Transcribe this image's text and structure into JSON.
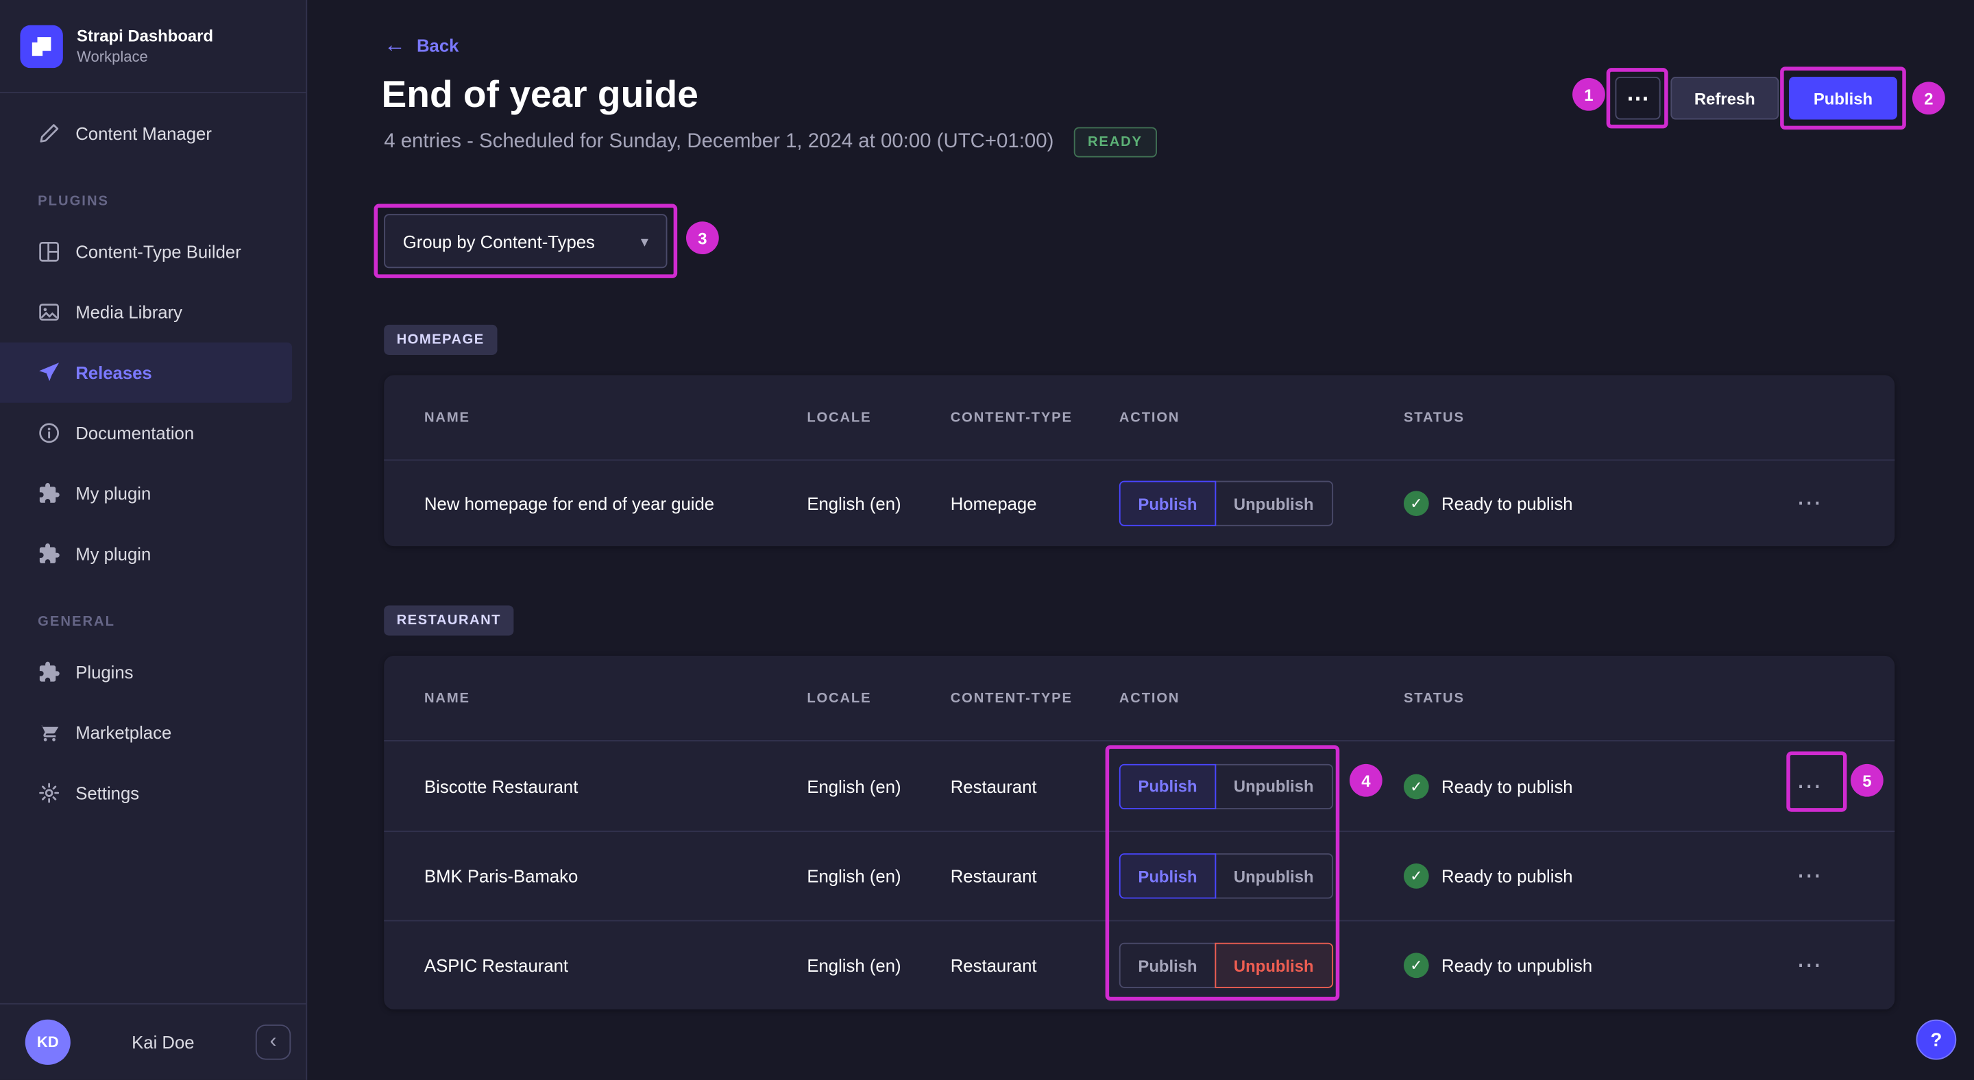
{
  "icons": {
    "back_arrow": "←",
    "more": "⋯",
    "caret": "▾",
    "collapse": "‹",
    "check": "✓",
    "help": "?"
  },
  "sidebar": {
    "brand": {
      "title": "Strapi Dashboard",
      "subtitle": "Workplace"
    },
    "content_manager": "Content Manager",
    "sections": [
      {
        "heading": "PLUGINS",
        "items": [
          {
            "label": "Content-Type Builder"
          },
          {
            "label": "Media Library"
          },
          {
            "label": "Releases"
          },
          {
            "label": "Documentation"
          },
          {
            "label": "My plugin"
          },
          {
            "label": "My plugin"
          }
        ]
      },
      {
        "heading": "GENERAL",
        "items": [
          {
            "label": "Plugins"
          },
          {
            "label": "Marketplace"
          },
          {
            "label": "Settings"
          }
        ]
      }
    ],
    "user": {
      "initials": "KD",
      "name": "Kai Doe"
    }
  },
  "header": {
    "back": "Back",
    "title": "End of year guide",
    "subtitle": "4 entries - Scheduled for Sunday, December 1, 2024 at 00:00 (UTC+01:00)",
    "status": "READY",
    "refresh": "Refresh",
    "publish": "Publish"
  },
  "toolbar": {
    "group_by": "Group by Content-Types"
  },
  "table_columns": [
    "NAME",
    "LOCALE",
    "CONTENT-TYPE",
    "ACTION",
    "STATUS"
  ],
  "groups": [
    {
      "tag": "HOMEPAGE",
      "rows": [
        {
          "name": "New homepage for end of year guide",
          "locale": "English (en)",
          "content_type": "Homepage",
          "publish": "Publish",
          "unpublish": "Unpublish",
          "active": "publish",
          "status": "Ready to publish"
        }
      ]
    },
    {
      "tag": "RESTAURANT",
      "rows": [
        {
          "name": "Biscotte Restaurant",
          "locale": "English (en)",
          "content_type": "Restaurant",
          "publish": "Publish",
          "unpublish": "Unpublish",
          "active": "publish",
          "status": "Ready to publish"
        },
        {
          "name": "BMK Paris-Bamako",
          "locale": "English (en)",
          "content_type": "Restaurant",
          "publish": "Publish",
          "unpublish": "Unpublish",
          "active": "publish",
          "status": "Ready to publish"
        },
        {
          "name": "ASPIC Restaurant",
          "locale": "English (en)",
          "content_type": "Restaurant",
          "publish": "Publish",
          "unpublish": "Unpublish",
          "active": "unpublish",
          "status": "Ready to unpublish"
        }
      ]
    }
  ],
  "annotations": [
    {
      "label": "1"
    },
    {
      "label": "2"
    },
    {
      "label": "3"
    },
    {
      "label": "4"
    },
    {
      "label": "5"
    }
  ],
  "colors": {
    "background": "#181826",
    "surface": "#212134",
    "primary": "#4945ff",
    "primary_text": "#7b79ff",
    "success": "#5cb176",
    "danger": "#ee5e52",
    "annotation": "#d02bd0"
  }
}
